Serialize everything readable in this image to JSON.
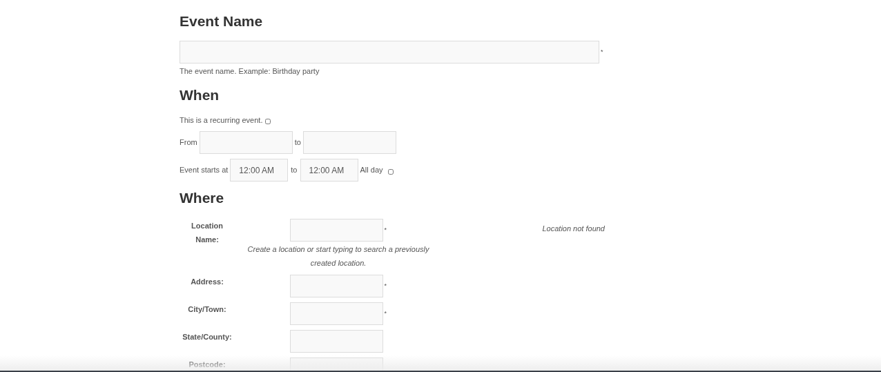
{
  "event_name": {
    "heading": "Event Name",
    "required_mark": "*",
    "hint": "The event name. Example: Birthday party"
  },
  "when": {
    "heading": "When",
    "recurring": {
      "label": "This is a recurring event.",
      "checked": false
    },
    "dates": {
      "from_label": "From",
      "to_label": "to"
    },
    "times": {
      "label": "Event starts at",
      "start": "12:00 AM",
      "to_label": "to",
      "end": "12:00 AM",
      "all_day": {
        "label": "All day",
        "checked": false
      }
    }
  },
  "where": {
    "heading": "Where",
    "status": "Location not found",
    "fields": [
      {
        "label": "Location Name:",
        "required_mark": "*",
        "hint": "Create a location or start typing to search a previously created location."
      },
      {
        "label": "Address:",
        "required_mark": "*"
      },
      {
        "label": "City/Town:",
        "required_mark": "*"
      },
      {
        "label": "State/County:"
      },
      {
        "label": "Postcode:"
      }
    ]
  }
}
